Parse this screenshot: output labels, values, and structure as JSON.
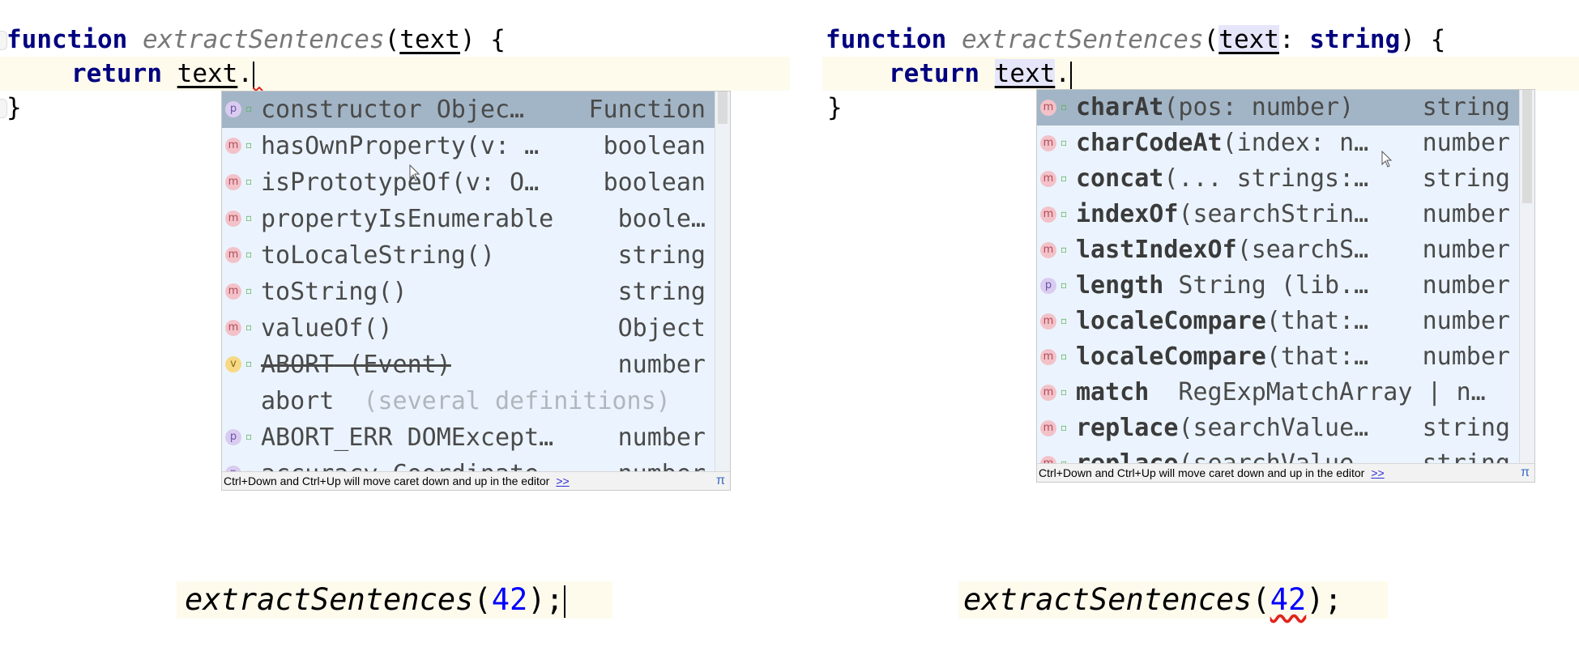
{
  "left_editor": {
    "line1": {
      "keyword": "function",
      "name": "extractSentences",
      "open": "(",
      "param": "text",
      "close": ") {"
    },
    "line2": {
      "keyword": "return",
      "object": "text",
      "dot": "."
    },
    "line3": {
      "brace": "}"
    },
    "popup": {
      "items": [
        {
          "icon": "p",
          "name": "constructor",
          "tail": " Objec…",
          "type": "Function",
          "selected": true
        },
        {
          "icon": "m",
          "name": "hasOwnProperty",
          "tail": "(v: …",
          "type": "boolean"
        },
        {
          "icon": "m",
          "name": "isPrototypeOf",
          "tail": "(v: O…",
          "type": "boolean"
        },
        {
          "icon": "m",
          "name": "propertyIsEnumerable",
          "tail": "",
          "type": "boole…"
        },
        {
          "icon": "m",
          "name": "toLocaleString",
          "tail": "()",
          "type": "string"
        },
        {
          "icon": "m",
          "name": "toString",
          "tail": "()",
          "type": "string"
        },
        {
          "icon": "m",
          "name": "valueOf",
          "tail": "()",
          "type": "Object"
        },
        {
          "icon": "v",
          "name": "ABORT",
          "tail": " (Event)",
          "type": "number",
          "deprecated": true
        },
        {
          "icon": "",
          "name": "abort",
          "tail": "  (several definitions)",
          "type": ""
        },
        {
          "icon": "p",
          "name": "ABORT_ERR",
          "tail": " DOMExcept…",
          "type": "number"
        },
        {
          "icon": "p",
          "name": "accuracy",
          "tail": " Coordinate…",
          "type": "number"
        }
      ],
      "footer_hint": "Ctrl+Down and Ctrl+Up will move caret down and up in the editor",
      "footer_link": ">>",
      "footer_icon": "π"
    },
    "call": {
      "name": "extractSentences",
      "open": "(",
      "arg": "42",
      "close": ");"
    }
  },
  "right_editor": {
    "line1": {
      "keyword": "function",
      "name": "extractSentences",
      "open": "(",
      "param": "text",
      "colon": ": ",
      "type": "string",
      "close": ") {"
    },
    "line2": {
      "keyword": "return",
      "object": "text",
      "dot": "."
    },
    "line3": {
      "brace": "}"
    },
    "popup": {
      "items": [
        {
          "icon": "m",
          "name": "charAt",
          "tail": "(pos: number)",
          "type": "string",
          "selected": true
        },
        {
          "icon": "m",
          "name": "charCodeAt",
          "tail": "(index: n…",
          "type": "number"
        },
        {
          "icon": "m",
          "name": "concat",
          "tail": "(... strings:…",
          "type": "string"
        },
        {
          "icon": "m",
          "name": "indexOf",
          "tail": "(searchStrin…",
          "type": "number"
        },
        {
          "icon": "m",
          "name": "lastIndexOf",
          "tail": "(searchS…",
          "type": "number"
        },
        {
          "icon": "p",
          "name": "length",
          "tail": " String (lib.…",
          "type": "number"
        },
        {
          "icon": "m",
          "name": "localeCompare",
          "tail": "(that:…",
          "type": "number"
        },
        {
          "icon": "m",
          "name": "localeCompare",
          "tail": "(that:…",
          "type": "number"
        },
        {
          "icon": "m",
          "name": "match",
          "tail": "  RegExpMatchArray | n…",
          "type": ""
        },
        {
          "icon": "m",
          "name": "replace",
          "tail": "(searchValue…",
          "type": "string"
        },
        {
          "icon": "m",
          "name": "replace",
          "tail": "(searchValue…",
          "type": "string"
        }
      ],
      "footer_hint": "Ctrl+Down and Ctrl+Up will move caret down and up in the editor",
      "footer_link": ">>",
      "footer_icon": "π"
    },
    "call": {
      "name": "extractSentences",
      "open": "(",
      "arg": "42",
      "close": ");"
    }
  }
}
